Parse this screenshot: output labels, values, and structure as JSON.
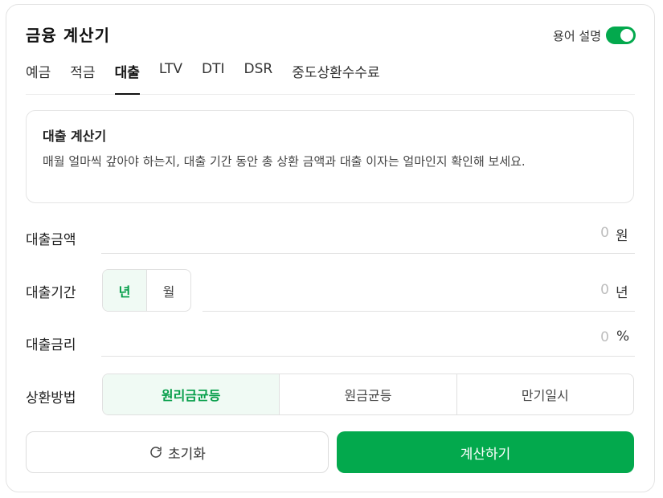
{
  "header": {
    "title": "금융 계산기",
    "glossary_label": "용어 설명",
    "glossary_toggle_on": true
  },
  "tabs": [
    {
      "label": "예금",
      "active": false
    },
    {
      "label": "적금",
      "active": false
    },
    {
      "label": "대출",
      "active": true
    },
    {
      "label": "LTV",
      "active": false
    },
    {
      "label": "DTI",
      "active": false
    },
    {
      "label": "DSR",
      "active": false
    },
    {
      "label": "중도상환수수료",
      "active": false
    }
  ],
  "info": {
    "title": "대출 계산기",
    "description": "매월 얼마씩 갚아야 하는지, 대출 기간 동안 총 상환 금액과 대출 이자는 얼마인지 확인해 보세요."
  },
  "form": {
    "amount": {
      "label": "대출금액",
      "value": "0",
      "unit": "원"
    },
    "period": {
      "label": "대출기간",
      "options": [
        {
          "label": "년",
          "active": true
        },
        {
          "label": "월",
          "active": false
        }
      ],
      "value": "0",
      "unit": "년"
    },
    "rate": {
      "label": "대출금리",
      "value": "0",
      "unit": "%"
    },
    "method": {
      "label": "상환방법",
      "options": [
        {
          "label": "원리금균등",
          "active": true
        },
        {
          "label": "원금균등",
          "active": false
        },
        {
          "label": "만기일시",
          "active": false
        }
      ]
    }
  },
  "actions": {
    "reset_label": "초기화",
    "reset_icon": "refresh-icon",
    "calculate_label": "계산하기"
  },
  "colors": {
    "accent": "#03a94d",
    "accent_light": "#f0faf4"
  }
}
